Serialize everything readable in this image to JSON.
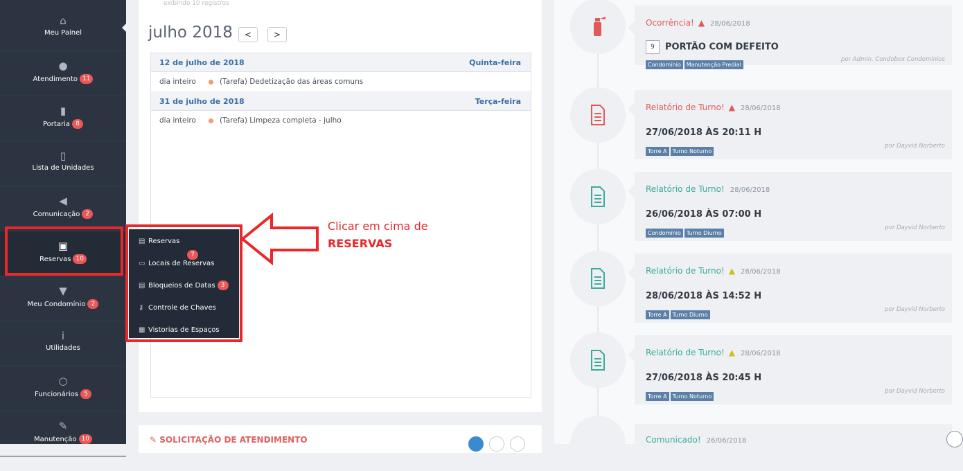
{
  "sidebar": {
    "items": [
      {
        "label": "Meu Painel",
        "icon": "home-icon",
        "glyph": "⌂",
        "badge": ""
      },
      {
        "label": "Atendimento",
        "icon": "microphone-icon",
        "glyph": "●",
        "badge": "11"
      },
      {
        "label": "Portaria",
        "icon": "door-icon",
        "glyph": "▮",
        "badge": "8"
      },
      {
        "label": "Lista de Unidades",
        "icon": "building-icon",
        "glyph": "▯",
        "badge": ""
      },
      {
        "label": "Comunicação",
        "icon": "megaphone-icon",
        "glyph": "◀",
        "badge": "2"
      },
      {
        "label": "Reservas",
        "icon": "calendar-check-icon",
        "glyph": "▣",
        "badge": "10"
      },
      {
        "label": "Meu Condomínio",
        "icon": "pin-icon",
        "glyph": "▼",
        "badge": "2"
      },
      {
        "label": "Utilidades",
        "icon": "info-icon",
        "glyph": "i",
        "badge": ""
      },
      {
        "label": "Funcionários",
        "icon": "circle-icon",
        "glyph": "○",
        "badge": "5"
      },
      {
        "label": "Manutenção",
        "icon": "wrench-icon",
        "glyph": "✎",
        "badge": "10"
      }
    ]
  },
  "calendar": {
    "top_text": "exibindo 10 registros",
    "month_label": "julho 2018",
    "prev_label": "<",
    "next_label": ">",
    "days": [
      {
        "date": "12 de julho de 2018",
        "weekday": "Quinta-feira",
        "time": "dia inteiro",
        "event": "(Tarefa) Dedetização das áreas comuns"
      },
      {
        "date": "31 de julho de 2018",
        "weekday": "Terça-feira",
        "time": "dia inteiro",
        "event": "(Tarefa) Limpeza completa - julho"
      }
    ]
  },
  "solicitacao": {
    "title": "SOLICITAÇÃO DE ATENDIMENTO",
    "pages": [
      "1",
      "2",
      "3"
    ]
  },
  "submenu": {
    "items": [
      {
        "label": "Reservas",
        "icon": "calendar-icon",
        "glyph": "▤",
        "badge": "7"
      },
      {
        "label": "Locais de Reservas",
        "icon": "bookmark-icon",
        "glyph": "▭",
        "badge": ""
      },
      {
        "label": "Bloqueios de Datas",
        "icon": "calendar-lock-icon",
        "glyph": "▤",
        "badge": "3"
      },
      {
        "label": "Controle de Chaves",
        "icon": "key-icon",
        "glyph": "⚷",
        "badge": ""
      },
      {
        "label": "Vistorias de Espaços",
        "icon": "copy-icon",
        "glyph": "▦",
        "badge": ""
      }
    ]
  },
  "annotation": {
    "line1": "Clicar em cima de",
    "line2": "RESERVAS",
    "color": "#e8282b"
  },
  "timeline": [
    {
      "icon": "fire-extinguisher-icon",
      "title": "Ocorrência!",
      "title_color": "#e05a5a",
      "warn": "red",
      "date": "28/06/2018",
      "num": "9",
      "main": "PORTÃO COM DEFEITO",
      "tags": [
        "Condomínio",
        "Manutenção Predial"
      ],
      "by": "por Admin. Condobox Condominios"
    },
    {
      "icon": "document-red-icon",
      "title": "Relatório de Turno!",
      "title_color": "#e05a5a",
      "warn": "red",
      "date": "28/06/2018",
      "num": "",
      "main": "27/06/2018 ÀS 20:11 H",
      "tags": [
        "Torre A",
        "Turno Noturno"
      ],
      "by": "por Dayvid Norberto"
    },
    {
      "icon": "document-green-icon",
      "title": "Relatório de Turno!",
      "title_color": "#3cab9a",
      "warn": "",
      "date": "28/06/2018",
      "num": "",
      "main": "26/06/2018 ÀS 07:00 H",
      "tags": [
        "Condomínio",
        "Turno Diurno"
      ],
      "by": "por Dayvid Norberto"
    },
    {
      "icon": "document-green-icon",
      "title": "Relatório de Turno!",
      "title_color": "#3cab9a",
      "warn": "yellow",
      "date": "28/06/2018",
      "num": "",
      "main": "28/06/2018 ÀS 14:52 H",
      "tags": [
        "Torre A",
        "Turno Diurno"
      ],
      "by": "por Dayvid Norberto"
    },
    {
      "icon": "document-green-icon",
      "title": "Relatório de Turno!",
      "title_color": "#3cab9a",
      "warn": "yellow",
      "date": "28/06/2018",
      "num": "",
      "main": "27/06/2018 ÀS 20:45 H",
      "tags": [
        "Torre A",
        "Turno Noturno"
      ],
      "by": "por Dayvid Norberto"
    }
  ],
  "timeline_last": {
    "title": "Comunicado!",
    "date": "26/06/2018"
  }
}
